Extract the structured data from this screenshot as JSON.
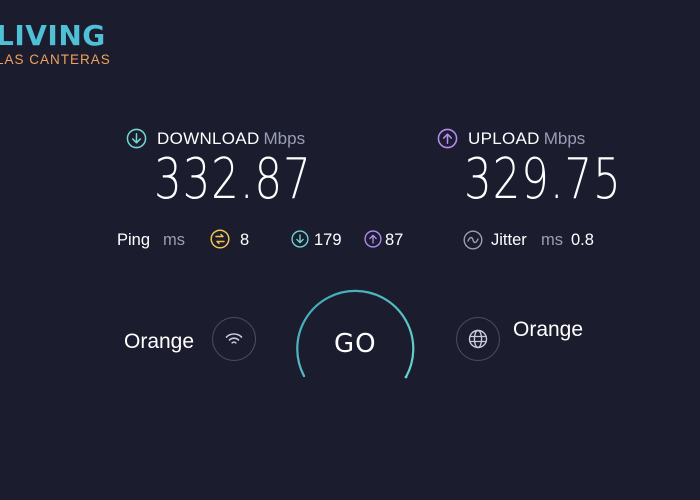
{
  "logo": {
    "main": "LIVING",
    "sub": "LAS CANTERAS"
  },
  "download": {
    "label": "DOWNLOAD",
    "unit": "Mbps",
    "value": "332.87",
    "icon": "download-arrow-icon",
    "color": "#6fd6d0"
  },
  "upload": {
    "label": "UPLOAD",
    "unit": "Mbps",
    "value": "329.75",
    "icon": "upload-arrow-icon",
    "color": "#b58cf2"
  },
  "ping": {
    "label": "Ping",
    "unit": "ms",
    "idle": "8",
    "download": "179",
    "upload": "87",
    "idle_color": "#f2c44d"
  },
  "jitter": {
    "label": "Jitter",
    "unit": "ms",
    "value": "0.8"
  },
  "provider": {
    "name": "Orange",
    "icon": "wifi-icon"
  },
  "server": {
    "name": "Orange",
    "icon": "globe-icon"
  },
  "go_button": {
    "label": "GO",
    "ring_color": "#5fc7d4"
  }
}
